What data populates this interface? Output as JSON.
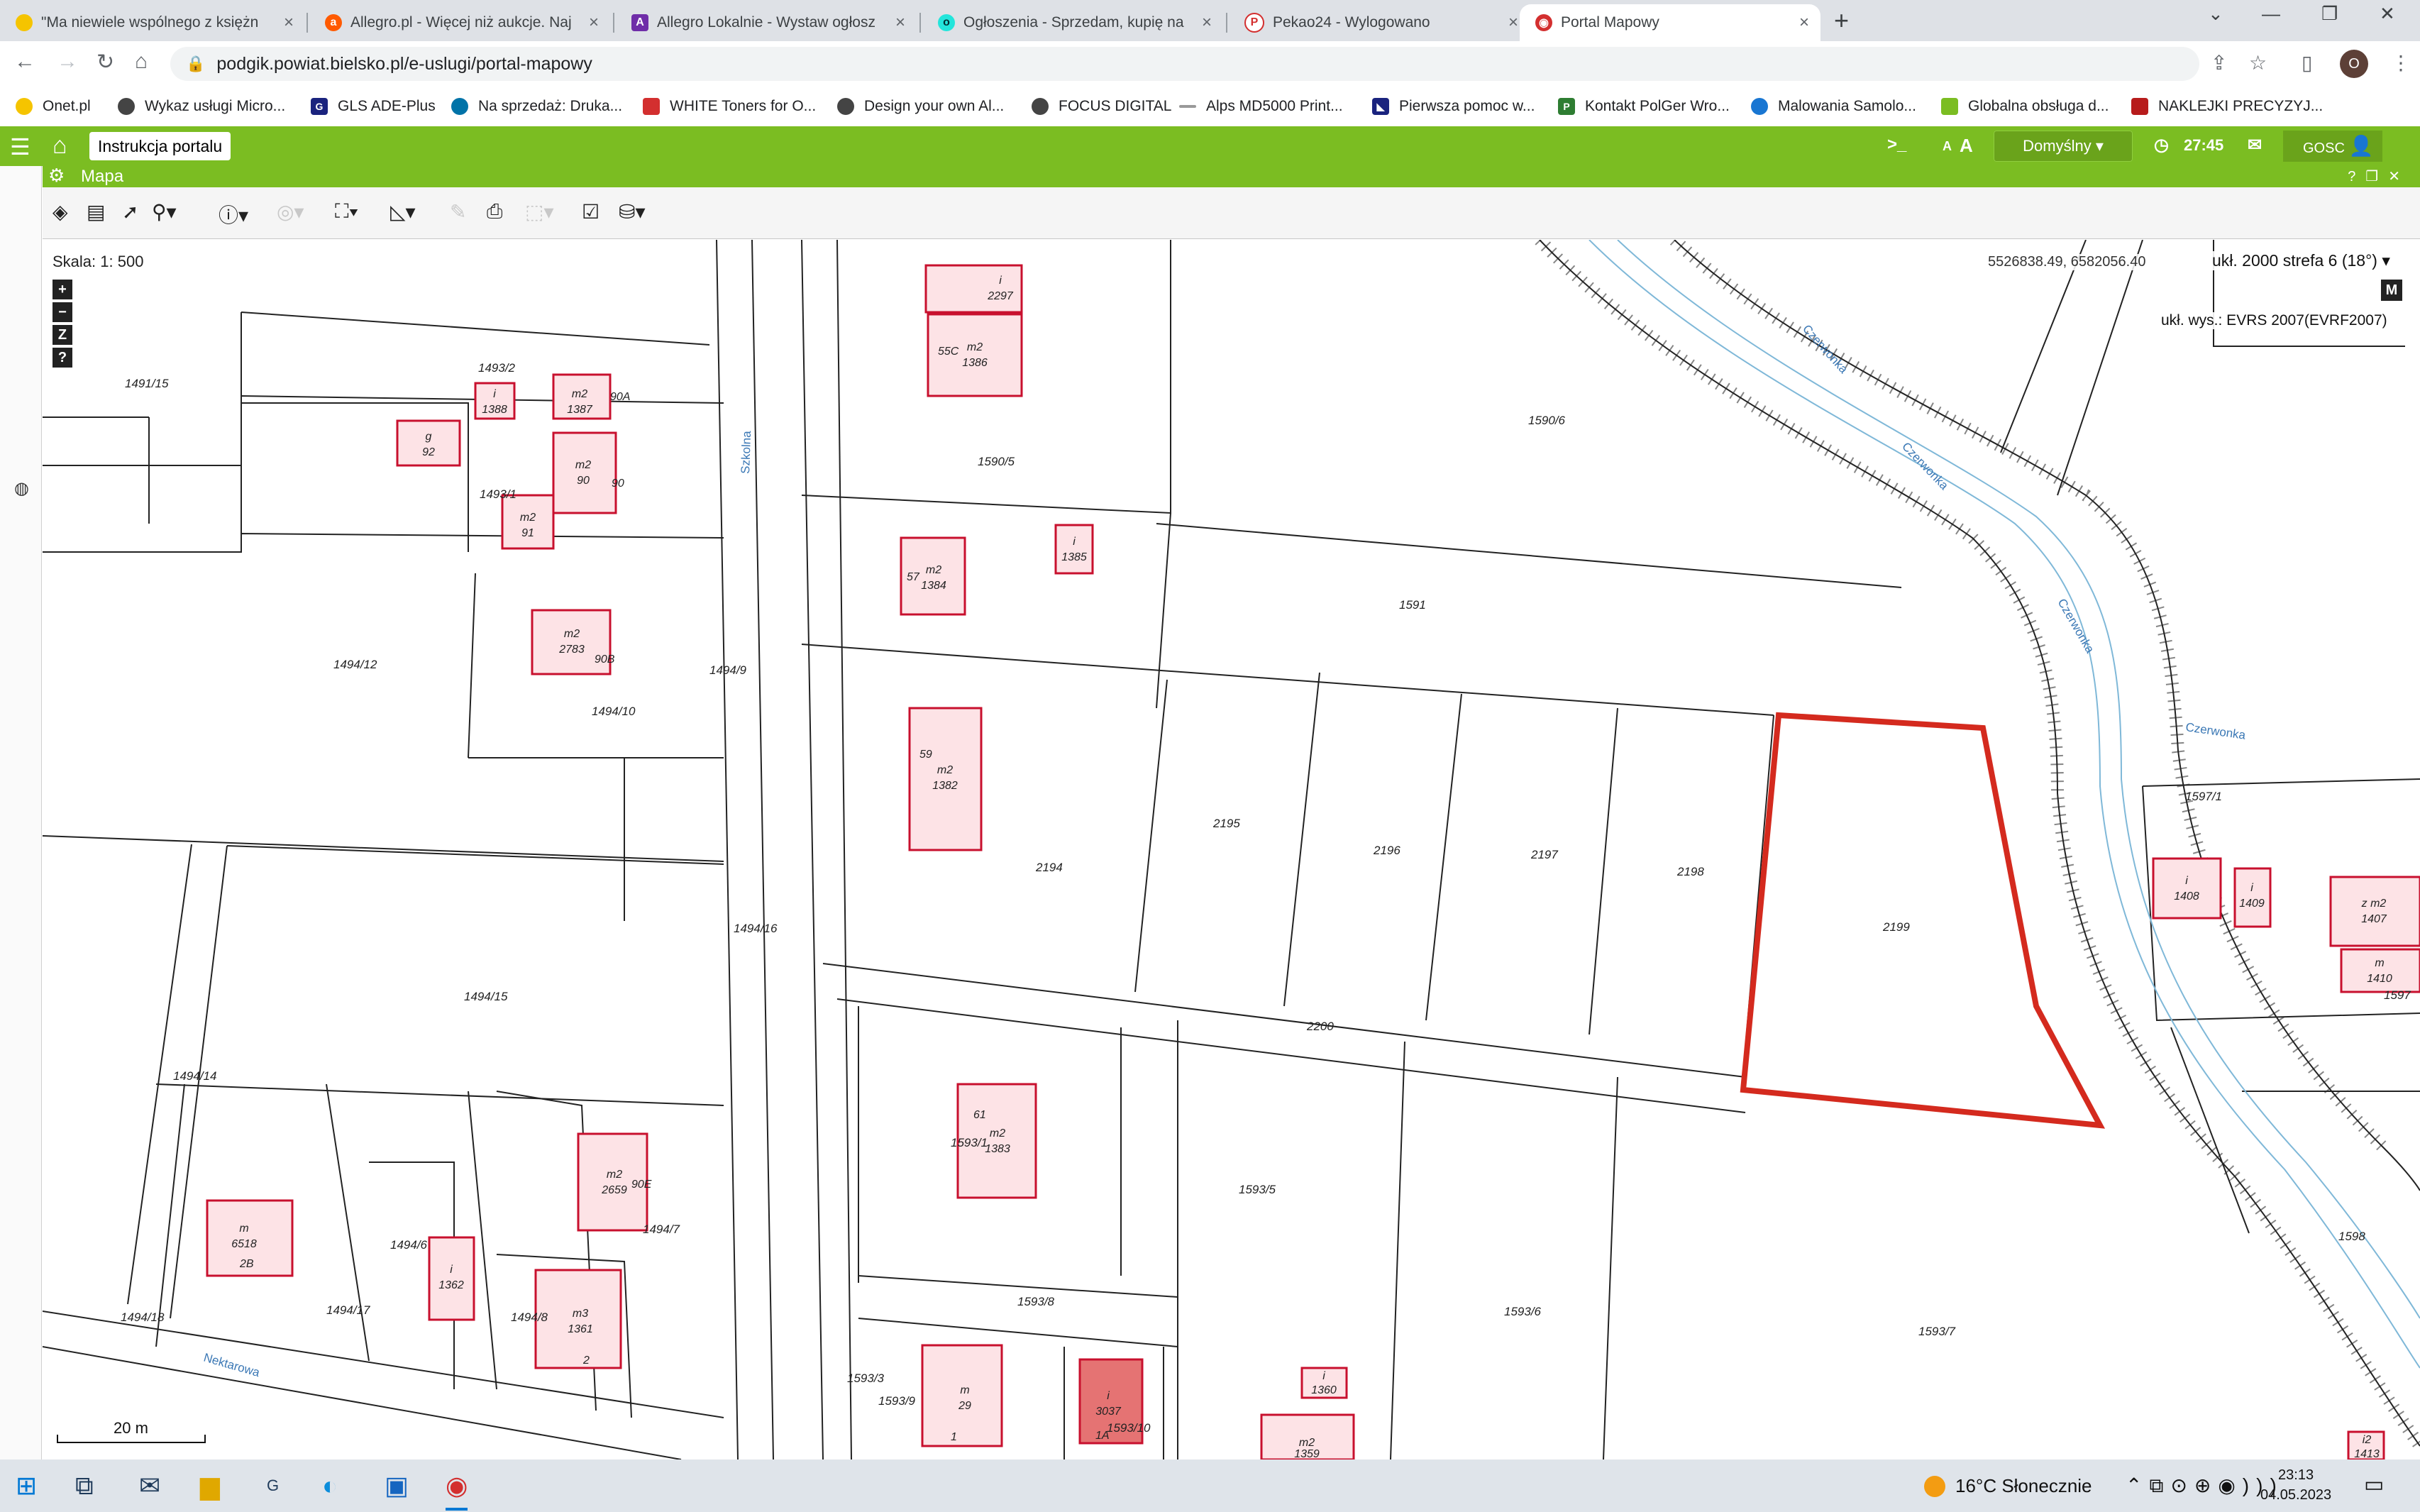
{
  "browser": {
    "tabs": [
      {
        "title": "\"Ma niewiele wspólnego z księżn",
        "icon": "yellow-dot-icon"
      },
      {
        "title": "Allegro.pl - Więcej niż aukcje. Naj",
        "icon": "allegro-icon"
      },
      {
        "title": "Allegro Lokalnie - Wystaw ogłosz",
        "icon": "allegro-lokalnie-icon"
      },
      {
        "title": "Ogłoszenia - Sprzedam, kupię na",
        "icon": "olx-icon"
      },
      {
        "title": "Pekao24 - Wylogowano",
        "icon": "pekao-icon"
      },
      {
        "title": "Portal Mapowy",
        "icon": "portal-icon",
        "active": true
      }
    ],
    "url": "podgik.powiat.bielsko.pl/e-uslugi/portal-mapowy",
    "avatar_letter": "O",
    "bookmarks": [
      {
        "label": "Onet.pl",
        "color": "#f5c400"
      },
      {
        "label": "Wykaz usługi Micro...",
        "color": "#444444"
      },
      {
        "label": "GLS ADE-Plus",
        "color": "#1a237e"
      },
      {
        "label": "Na sprzedaż: Druka...",
        "color": "#0073a8"
      },
      {
        "label": "WHITE Toners for O...",
        "color": "#d32f2f"
      },
      {
        "label": "Design your own Al...",
        "color": "#444444"
      },
      {
        "label": "FOCUS DIGITAL",
        "color": "#444444"
      },
      {
        "label": "Alps MD5000 Print...",
        "color": "#999999"
      },
      {
        "label": "Pierwsza pomoc w...",
        "color": "#1a237e"
      },
      {
        "label": "Kontakt PolGer Wro...",
        "color": "#2e7d32"
      },
      {
        "label": "Malowania Samolo...",
        "color": "#1976d2"
      },
      {
        "label": "Globalna obsługa d...",
        "color": "#7bbd22"
      },
      {
        "label": "NAKLEJKI PRECYZYJ...",
        "color": "#b71c1c"
      }
    ]
  },
  "app": {
    "instr_label": "Instrukcja portalu",
    "timer": "27:45",
    "font_a_small": "A",
    "font_a_large": "A",
    "profile": "Domyślny",
    "user": "GOSC",
    "map_title": "Mapa",
    "accent": "#7bbd22"
  },
  "map": {
    "scale_prefix": "Skala:",
    "scale_value": "1: 500",
    "coords": "5526838.49, 6582056.40",
    "crs": "ukł. 2000 strefa 6 (18°)",
    "vertical_crs": "ukł. wys.: EVRS 2007(EVRF2007)",
    "m_button": "M",
    "zoom_buttons": [
      "+",
      "−",
      "Z",
      "?"
    ],
    "scalebar_label": "20 m",
    "streets": [
      "Szkolna",
      "Nektarowa",
      "Czerwonka",
      "Czerwonka",
      "Czerwonka",
      "Czerwonka"
    ],
    "highlight_color": "#d42a1e",
    "parcels": [
      "1491/15",
      "1493/2",
      "1493/1",
      "1494/12",
      "1494/10",
      "1494/9",
      "1494/16",
      "1494/15",
      "1494/14",
      "1494/6",
      "1494/7",
      "1494/8",
      "1494/17",
      "1494/18",
      "1590/5",
      "1590/6",
      "1591",
      "2194",
      "2195",
      "2196",
      "2197",
      "2198",
      "2199",
      "2200",
      "1597/1",
      "1597",
      "1593/1",
      "1593/5",
      "1593/6",
      "1593/7",
      "1593/8",
      "1593/3",
      "1593/9",
      "1593/10",
      "1598",
      "g"
    ],
    "buildings": [
      {
        "type": "i",
        "num": "1388"
      },
      {
        "type": "m2",
        "num": "1387"
      },
      {
        "type": "g",
        "num": "92"
      },
      {
        "type": "m2",
        "num": "90"
      },
      {
        "type": "m2",
        "num": "91"
      },
      {
        "type": "m2",
        "num": "2783"
      },
      {
        "type": "i",
        "num": "2297"
      },
      {
        "type": "m2",
        "num": "1386"
      },
      {
        "type": "m2",
        "num": "1384"
      },
      {
        "type": "i",
        "num": "1385"
      },
      {
        "type": "m2",
        "num": "1382"
      },
      {
        "type": "m2",
        "num": "1383"
      },
      {
        "type": "m2",
        "num": "2659"
      },
      {
        "type": "m",
        "num": "6518"
      },
      {
        "type": "i",
        "num": "1362"
      },
      {
        "type": "m3",
        "num": "1361"
      },
      {
        "type": "m",
        "num": "29"
      },
      {
        "type": "i",
        "num": "3037"
      },
      {
        "type": "i",
        "num": "1360"
      },
      {
        "type": "m2",
        "num": "1359"
      },
      {
        "type": "i",
        "num": "1408"
      },
      {
        "type": "i",
        "num": "1409"
      },
      {
        "type": "z m2",
        "num": "1407"
      },
      {
        "type": "m",
        "num": "1410"
      },
      {
        "type": "i2",
        "num": "1413"
      }
    ],
    "house_numbers": [
      "90A",
      "90",
      "90B",
      "55C",
      "57",
      "59",
      "61",
      "90E",
      "2B",
      "2",
      "1",
      "1A"
    ]
  },
  "taskbar": {
    "weather": "16°C  Słonecznie",
    "time": "23:13",
    "date": "04.05.2023"
  }
}
